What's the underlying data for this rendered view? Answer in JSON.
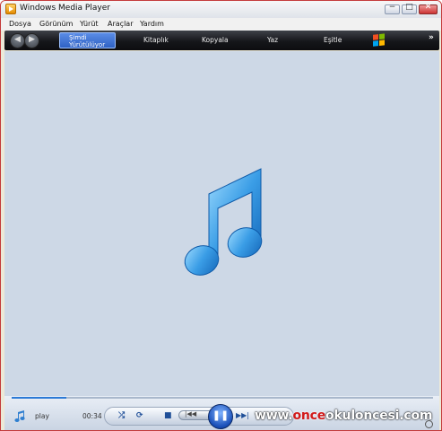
{
  "window": {
    "title": "Windows Media Player"
  },
  "caption_buttons": {
    "min": "−",
    "max": "□",
    "close": "✕"
  },
  "menu": [
    "Dosya",
    "Görünüm",
    "Yürüt",
    "Araçlar",
    "Yardım"
  ],
  "nav": {
    "back": "◀",
    "forward": "▶",
    "tabs": [
      {
        "line1": "Şimdi",
        "line2": "Yürütülüyor"
      },
      {
        "label": "Kitaplık"
      },
      {
        "label": "Kopyala"
      },
      {
        "label": "Yaz"
      },
      {
        "label": "Eşitle"
      }
    ],
    "more": "»"
  },
  "player": {
    "status": "play",
    "time": "00:34",
    "seek_progress": 0.13,
    "shuffle": "⤮",
    "repeat": "⟳",
    "stop": "■",
    "prev": "|◀◀",
    "play_pause": "❚❚",
    "next": "▶▶|"
  },
  "watermark": {
    "pre": "www.",
    "accent": "once",
    "post": "okuloncesi.com"
  },
  "icons": {
    "app": "media-player-icon",
    "note": "music-note-icon",
    "flag": "windows-logo-icon"
  }
}
